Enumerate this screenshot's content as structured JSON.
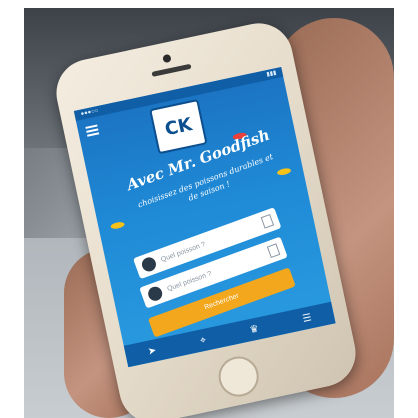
{
  "app": {
    "logo_text": "CK",
    "headline": "Avec Mr. Goodfish",
    "subline": "choisissez des poissons durables et de saison !",
    "search_field_1": "Quel poisson ?",
    "search_field_2": "Quel poisson ?",
    "cta_label": "Rechercher"
  },
  "tab_bar": {
    "icons": [
      "fish-icon",
      "location-icon",
      "chef-hat-icon",
      "list-icon"
    ]
  },
  "colors": {
    "screen_blue": "#1f8ad6",
    "button_orange": "#f2a71c",
    "phone_gold": "#e6dccb"
  }
}
